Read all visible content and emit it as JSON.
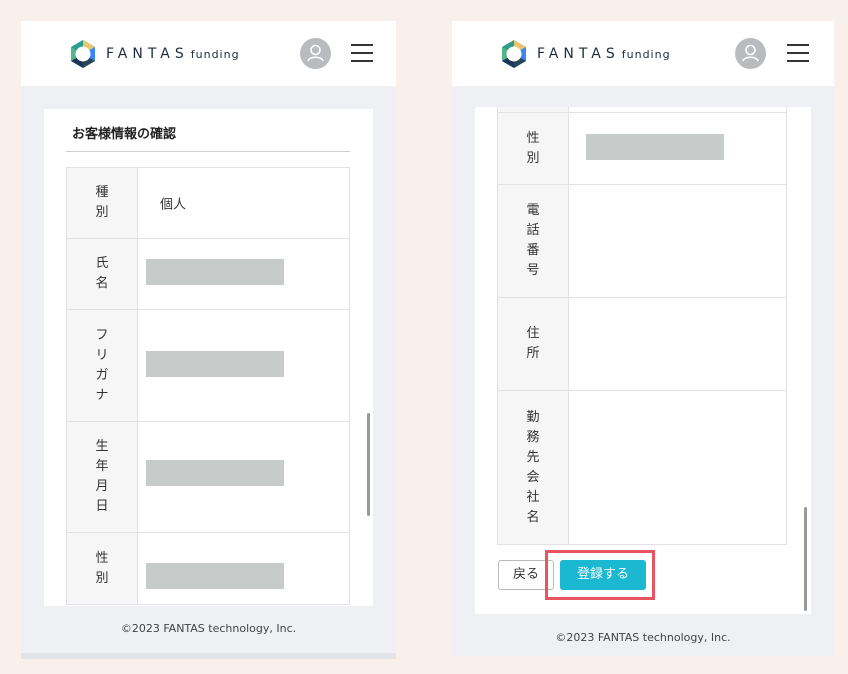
{
  "left_screen": {
    "logo_text": "FANTAS",
    "logo_sub": "funding",
    "section_title": "お客様情報の確認",
    "rows": [
      {
        "label": "種別",
        "value": "個人"
      },
      {
        "label": "氏名",
        "value": ""
      },
      {
        "label": "フリガナ",
        "value": ""
      },
      {
        "label": "生年月日",
        "value": ""
      },
      {
        "label": "性別",
        "value": ""
      }
    ],
    "footer": "©2023 FANTAS technology, Inc."
  },
  "right_screen": {
    "logo_text": "FANTAS",
    "logo_sub": "funding",
    "rows": [
      {
        "label": "性別",
        "value": ""
      },
      {
        "label": "電話番号",
        "value": ""
      },
      {
        "label": "住所",
        "value": ""
      },
      {
        "label": "勤務先会社名",
        "value": ""
      }
    ],
    "back_label": "戻る",
    "register_label": "登録する",
    "footer": "©2023 FANTAS technology, Inc."
  },
  "colors": {
    "accent": "#1ab8d1",
    "highlight": "#e85560",
    "page_background": "#f9f0ec"
  }
}
